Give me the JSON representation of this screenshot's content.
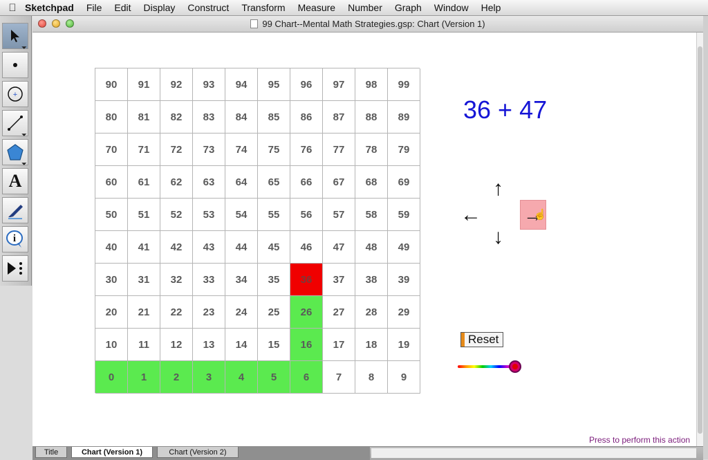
{
  "menubar": {
    "app_name": "Sketchpad",
    "items": [
      "File",
      "Edit",
      "Display",
      "Construct",
      "Transform",
      "Measure",
      "Number",
      "Graph",
      "Window",
      "Help"
    ]
  },
  "window": {
    "title": "99 Chart--Mental Math Strategies.gsp: Chart (Version 1)"
  },
  "toolbox": [
    {
      "name": "arrow-select-tool-icon",
      "selected": true
    },
    {
      "name": "point-tool-icon"
    },
    {
      "name": "compass-tool-icon"
    },
    {
      "name": "straightedge-tool-icon"
    },
    {
      "name": "polygon-tool-icon"
    },
    {
      "name": "text-tool-icon",
      "glyph": "A"
    },
    {
      "name": "marker-tool-icon"
    },
    {
      "name": "information-tool-icon",
      "glyph": "i"
    },
    {
      "name": "custom-tool-icon"
    }
  ],
  "chart": {
    "rows": [
      [
        "90",
        "91",
        "92",
        "93",
        "94",
        "95",
        "96",
        "97",
        "98",
        "99"
      ],
      [
        "80",
        "81",
        "82",
        "83",
        "84",
        "85",
        "86",
        "87",
        "88",
        "89"
      ],
      [
        "70",
        "71",
        "72",
        "73",
        "74",
        "75",
        "76",
        "77",
        "78",
        "79"
      ],
      [
        "60",
        "61",
        "62",
        "63",
        "64",
        "65",
        "66",
        "67",
        "68",
        "69"
      ],
      [
        "50",
        "51",
        "52",
        "53",
        "54",
        "55",
        "56",
        "57",
        "58",
        "59"
      ],
      [
        "40",
        "41",
        "42",
        "43",
        "44",
        "45",
        "46",
        "47",
        "48",
        "49"
      ],
      [
        "30",
        "31",
        "32",
        "33",
        "34",
        "35",
        "36",
        "37",
        "38",
        "39"
      ],
      [
        "20",
        "21",
        "22",
        "23",
        "24",
        "25",
        "26",
        "27",
        "28",
        "29"
      ],
      [
        "10",
        "11",
        "12",
        "13",
        "14",
        "15",
        "16",
        "17",
        "18",
        "19"
      ],
      [
        "0",
        "1",
        "2",
        "3",
        "4",
        "5",
        "6",
        "7",
        "8",
        "9"
      ]
    ],
    "highlight_green": [
      "0",
      "1",
      "2",
      "3",
      "4",
      "5",
      "6",
      "16",
      "26"
    ],
    "highlight_red": [
      "36"
    ],
    "colors": {
      "green": "#5bea4f",
      "red": "#f00000"
    }
  },
  "expression": "36 + 47",
  "arrows": {
    "up": "↑",
    "down": "↓",
    "left": "←",
    "right": "→"
  },
  "reset_label": "Reset",
  "status_text": "Press to perform this action",
  "tabs": [
    {
      "label": "Title",
      "active": false
    },
    {
      "label": "Chart (Version 1)",
      "active": true
    },
    {
      "label": "Chart (Version 2)",
      "active": false
    }
  ]
}
